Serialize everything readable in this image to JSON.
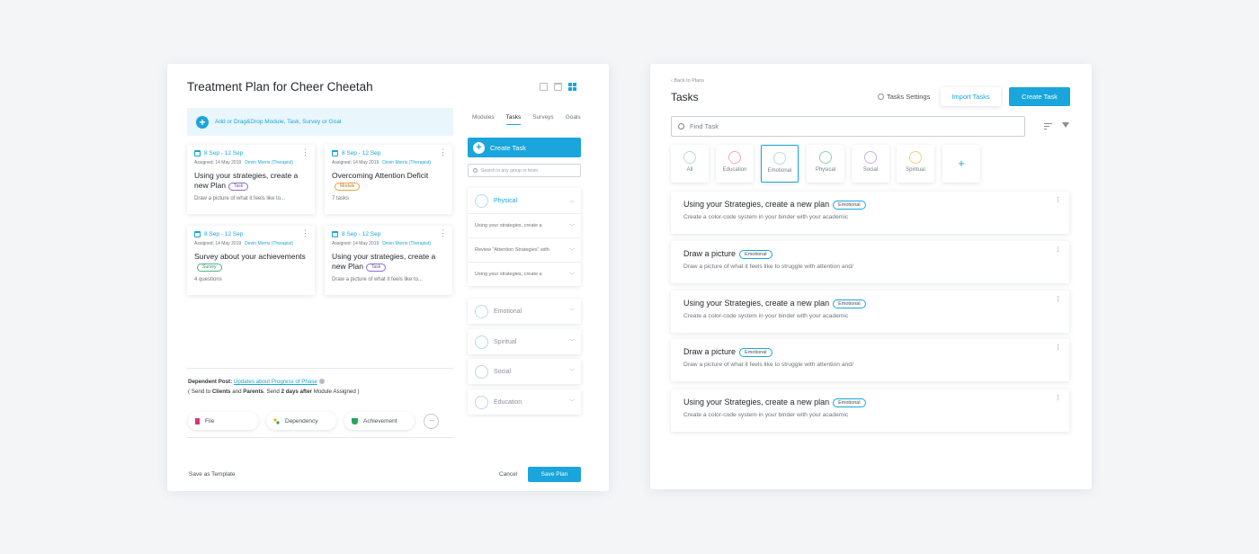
{
  "left": {
    "title": "Treatment Plan for Cheer Cheetah",
    "add_bar": "Add or Drag&Drop Module, Task, Survey or Goal",
    "cards": [
      {
        "date": "8 Sep - 12 Sep",
        "assigned": "Assigned: 14 May 2019",
        "who": "Devin Morris (Therapist)",
        "title": "Using your strategies, create a  new Plan",
        "tag": "Task",
        "sub": "Draw a picture of what it feels like to..."
      },
      {
        "date": "8 Sep - 12 Sep",
        "assigned": "Assigned: 14 May 2019",
        "who": "Devin Morris (Therapist)",
        "title": "Overcoming Attention Deficit",
        "tag": "Module",
        "sub": "7 tasks"
      },
      {
        "date": "8 Sep - 12 Sep",
        "assigned": "Assigned: 14 May 2019",
        "who": "Devin Morris (Therapist)",
        "title": "Survey about your achievements",
        "tag": "Survey",
        "sub": "4 questions"
      },
      {
        "date": "8 Sep - 12 Sep",
        "assigned": "Assigned: 14 May 2019",
        "who": "Devin Morris (Therapist)",
        "title": "Using your strategies, create a  new Plan",
        "tag": "Task",
        "sub": "Draw a picture of what it feels like to..."
      }
    ],
    "dependent": {
      "label": "Dependent Post:",
      "link": "Updates about Progress of Phase",
      "line2_a": "( Send to ",
      "clients": "Clients",
      "and": " and ",
      "parents": "Parents",
      "mid": ". Send ",
      "days": "2 days after",
      "tail": " Module Assigned )"
    },
    "chips": [
      "File",
      "Dependency",
      "Achievement"
    ],
    "chip_more": "···",
    "save_template": "Save as Template",
    "cancel": "Cancel",
    "save_plan": "Save Plan",
    "tabs": [
      "Modules",
      "Tasks",
      "Surveys",
      "Goals"
    ],
    "create_task": "Create Task",
    "search_placeholder": "Search in any group or team",
    "groups": [
      {
        "name": "Physical",
        "open": true,
        "items": [
          "Using your strategies, create a",
          "Review \"Attention Strategies\" with",
          "Using your strategies, create a"
        ]
      },
      {
        "name": "Emotional",
        "open": false
      },
      {
        "name": "Spiritual",
        "open": false
      },
      {
        "name": "Social",
        "open": false
      },
      {
        "name": "Education",
        "open": false
      }
    ]
  },
  "right": {
    "back": "Back to Plans",
    "title": "Tasks",
    "settings": "Tasks Settings",
    "import": "Import Tasks",
    "create": "Create Task",
    "find_placeholder": "Find  Task",
    "categories": [
      "All",
      "Education",
      "Emotional",
      "Physical",
      "Social",
      "Spiritual"
    ],
    "tasks": [
      {
        "title": "Using your Strategies, create a new plan",
        "tag": "Emotional",
        "desc": "Create a color-code system in your binder with your academic"
      },
      {
        "title": "Draw a picture",
        "tag": "Emotional",
        "desc": "Draw a picture of what it feels like to struggle with attention and/"
      },
      {
        "title": "Using your Strategies, create a new plan",
        "tag": "Emotional",
        "desc": "Create a color-code system in your binder with your academic"
      },
      {
        "title": "Draw a picture",
        "tag": "Emotional",
        "desc": "Draw a picture of what it feels like to struggle with attention and/"
      },
      {
        "title": "Using your Strategies, create a new plan",
        "tag": "Emotional",
        "desc": "Create a color-code system in your binder with your academic"
      }
    ]
  }
}
